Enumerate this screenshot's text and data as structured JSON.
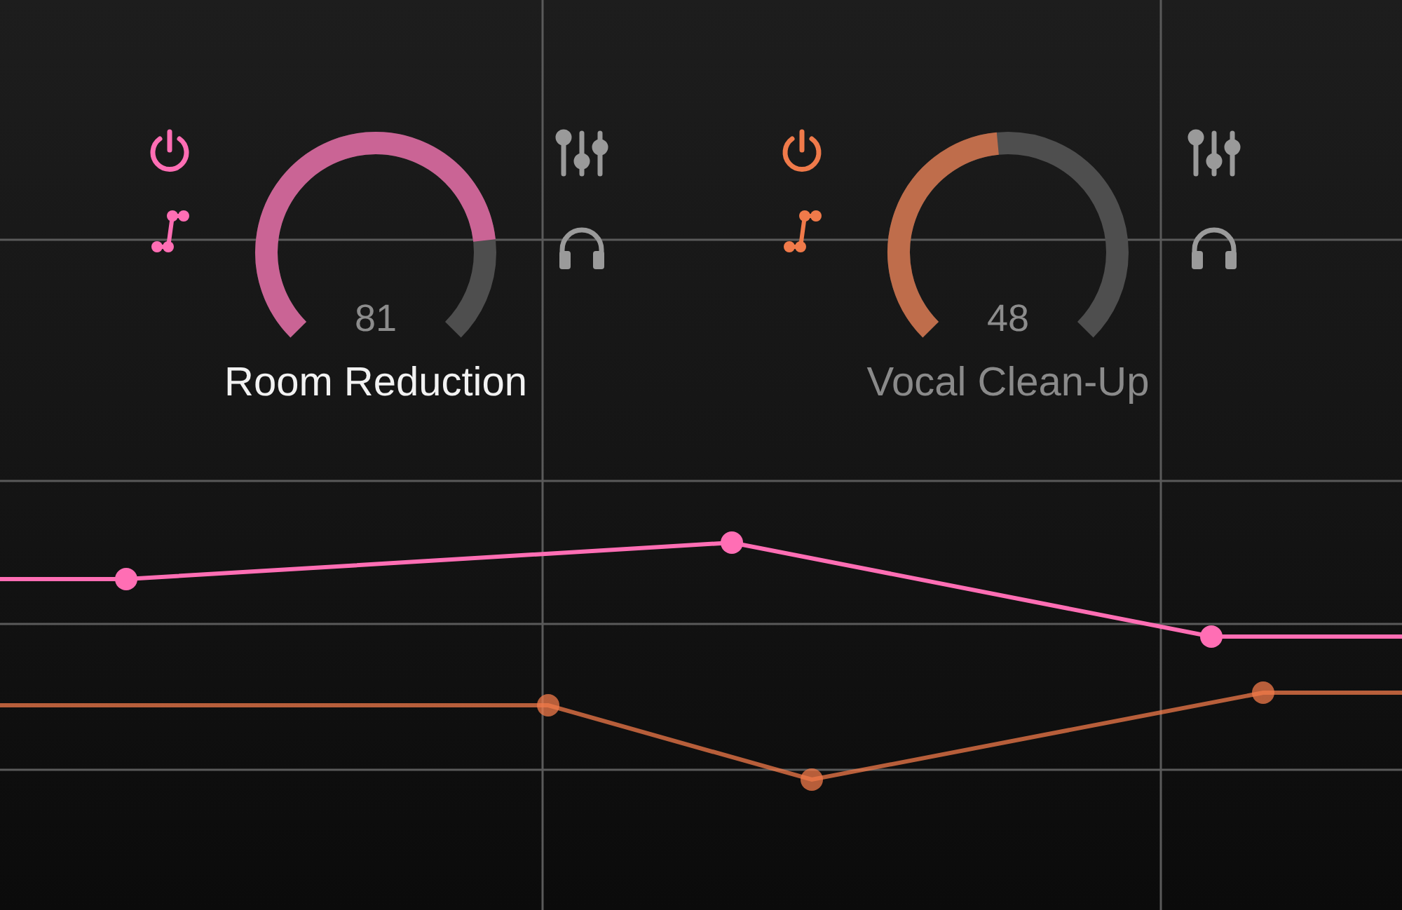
{
  "modules": [
    {
      "name": "Room Reduction",
      "value": "81",
      "color": "#ff6eb4",
      "selected": true
    },
    {
      "name": "Vocal Clean-Up",
      "value": "48",
      "color": "#f07a4a",
      "selected": false
    }
  ]
}
